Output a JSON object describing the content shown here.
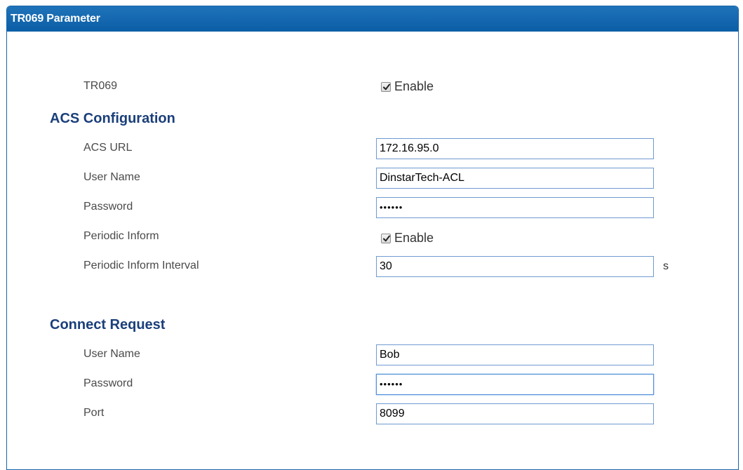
{
  "panel": {
    "title": "TR069 Parameter"
  },
  "tr069": {
    "label": "TR069",
    "enabled": true,
    "enable_label": "Enable"
  },
  "acs": {
    "section_title": "ACS Configuration",
    "url_label": "ACS URL",
    "url_value": "172.16.95.0",
    "username_label": "User Name",
    "username_value": "DinstarTech-ACL",
    "password_label": "Password",
    "password_value": "••••••",
    "periodic_inform_label": "Periodic Inform",
    "periodic_inform_enabled": true,
    "periodic_inform_enable_label": "Enable",
    "interval_label": "Periodic Inform Interval",
    "interval_value": "30",
    "interval_unit": "s"
  },
  "connect_request": {
    "section_title": "Connect Request",
    "username_label": "User Name",
    "username_value": "Bob",
    "password_label": "Password",
    "password_value": "••••••",
    "port_label": "Port",
    "port_value": "8099"
  },
  "colors": {
    "header_bg": "#0b5ea6",
    "section_title": "#1a3f7a",
    "field_border": "#6f9ad0"
  },
  "icons": {
    "checkbox": "checkmark-icon"
  }
}
